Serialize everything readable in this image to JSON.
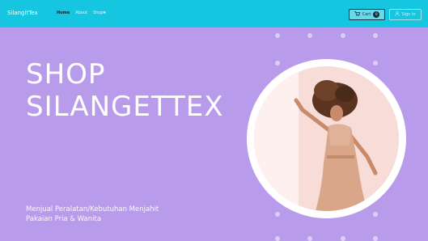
{
  "navbar": {
    "brand": "SilangitTex",
    "links": [
      {
        "label": "Home"
      },
      {
        "label": "About"
      },
      {
        "label": "Shop"
      }
    ],
    "cart": {
      "label": "Cart",
      "count": "0"
    },
    "signin": {
      "label": "Sign In"
    }
  },
  "hero": {
    "title_line1": "SHOP",
    "title_line2": "SILANGETTEX",
    "subtitle_line1": "Menjual Peralatan/Kebutuhan Menjahit",
    "subtitle_line2": "Pakaian Pria & Wanita"
  },
  "colors": {
    "navbar_bg": "#16c5e0",
    "hero_bg": "#b99bec",
    "photo_bg": "#f8dcd8"
  },
  "icons": [
    "cart-icon",
    "user-icon",
    "caret-down-icon"
  ]
}
